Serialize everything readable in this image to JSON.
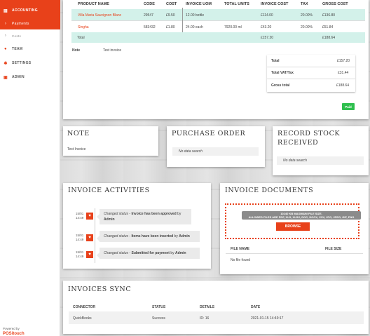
{
  "sidebar": {
    "items": [
      {
        "label": "ACCOUNTING",
        "icon": "document-icon"
      },
      {
        "label": "Payments",
        "icon": "chevron-right-icon"
      },
      {
        "label": "Costs",
        "icon": "chevron-right-icon"
      },
      {
        "label": "TEAM",
        "icon": "users-icon"
      },
      {
        "label": "SETTINGS",
        "icon": "gear-icon"
      },
      {
        "label": "ADMIN",
        "icon": "admin-icon"
      }
    ],
    "powered_by": "Powered by",
    "powered_logo": "POSitouch"
  },
  "invoice_table": {
    "headers": [
      "PRODUCT NAME",
      "CODE",
      "COST",
      "INVOICE UOM",
      "TOTAL UNITS",
      "INVOICE COST",
      "TAX",
      "GROSS COST"
    ],
    "rows": [
      [
        "Villa Maria Sauvignon Blanc",
        "29547",
        "£9.50",
        "12.00 bottle",
        "",
        "£114.00",
        "20.00%",
        "£136.80"
      ],
      [
        "Singha",
        "583432",
        "£1.80",
        "24.00 each",
        "7920.00 ml",
        "£43.20",
        "20.00%",
        "£51.84"
      ]
    ],
    "total_label": "Total",
    "total_invoice_cost": "£157.20",
    "total_gross_cost": "£188.64",
    "note_label": "Note",
    "note_value": "Test invoice"
  },
  "summary": {
    "total_label": "Total",
    "total_value": "£157.20",
    "vat_label": "Total VAT/Tax",
    "vat_value": "£31.44",
    "gross_label": "Gross total",
    "gross_value": "£188.64"
  },
  "paid_button": "Paid",
  "note_panel": {
    "title": "NOTE",
    "text": "Test Invoice"
  },
  "purchase_order_panel": {
    "title": "PURCHASE ORDER",
    "empty": "No data search"
  },
  "record_stock_panel": {
    "title_line1": "RECORD STOCK",
    "title_line2": "RECEIVED",
    "empty": "No data search"
  },
  "activities_panel": {
    "title": "INVOICE ACTIVITIES",
    "items": [
      {
        "date": "15/01",
        "time": "14:49",
        "prefix": "Changed status",
        "sep": " - ",
        "event": "Invoice has been approved",
        "by": " by ",
        "user": "Admin"
      },
      {
        "date": "15/01",
        "time": "14:49",
        "prefix": "Changed status",
        "sep": " - ",
        "event": "Items have been inserted",
        "by": " by ",
        "user": "Admin"
      },
      {
        "date": "15/01",
        "time": "14:49",
        "prefix": "Changed status",
        "sep": " - ",
        "event": "Submitted for payment",
        "by": " by ",
        "user": "Admin"
      }
    ]
  },
  "documents_panel": {
    "title": "INVOICE DOCUMENTS",
    "max_size": "10240 KB MAXIMUM FILE SIZE.",
    "allowed": "ALLOWED FILES ARE PDF, XLS, XLSX, DOC, DOCX, CSV, JPG, JPEG, GIF, PNG",
    "browse": "BROWSE",
    "col_name": "FILE NAME",
    "col_size": "FILE SIZE",
    "empty": "No file found"
  },
  "sync_panel": {
    "title": "INVOICES SYNC",
    "headers": [
      "CONNECTOR",
      "STATUS",
      "DETAILS",
      "DATE"
    ],
    "row": [
      "QuickBooks",
      "Success",
      "ID: 16",
      "2021-01-15 14:49:17"
    ]
  }
}
